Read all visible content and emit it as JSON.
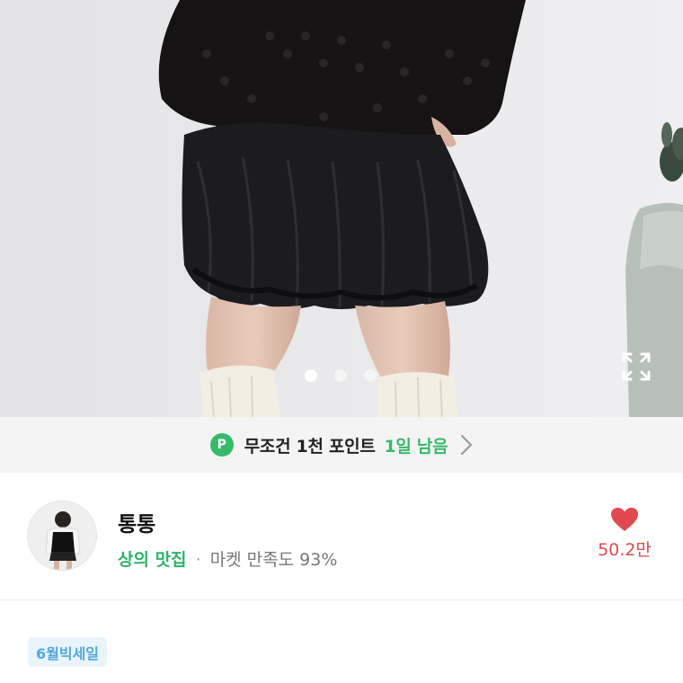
{
  "gallery": {
    "slide_count": 3,
    "active_slide": 1
  },
  "point_banner": {
    "badge": "P",
    "text": "무조건 1천 포인트",
    "remaining": "1일 남음"
  },
  "shop": {
    "name": "통통",
    "category": "상의 맛집",
    "separator": "·",
    "satisfaction": "마켓 만족도 93%",
    "likes": "50.2만"
  },
  "tags": [
    "6월빅세일"
  ],
  "colors": {
    "green": "#37b96a",
    "heart": "#e2484f",
    "tag_bg": "#e9f4fb",
    "tag_text": "#52a8de"
  },
  "icons": {
    "expand": "expand-icon",
    "chevron": "chevron-right-icon",
    "heart": "heart-icon"
  }
}
